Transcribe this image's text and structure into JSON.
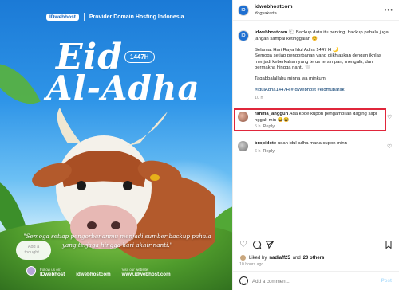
{
  "poster": {
    "brand_logo": "IDwebhost",
    "brand_tagline": "Provider Domain Hosting Indonesia",
    "title_eid": "Eid",
    "title_year": "1447H",
    "title_adha": "Al-Adha",
    "quote": "\"Semoga setiap pengorbananmu menjadi sumber backup pahala yang terjaga hingga hari akhir nanti.\"",
    "thought_bubble": "Add a thought...",
    "footer": {
      "follow_label": "Follow us on:",
      "handle_1": "IDwebhost",
      "handle_2": "idwebhostcom",
      "visit_label": "Visit our website:",
      "website": "www.idwebhost.com"
    }
  },
  "post": {
    "header": {
      "username": "idwebhostcom",
      "location": "Yogyakarta",
      "more_icon": "more-horizontal-icon"
    },
    "caption": {
      "username": "idwebhostcom",
      "p1": "🐑 Backup data itu penting, backup pahala juga jangan sampai ketinggalan 😊",
      "p2": "Selamat Hari Raya Idul Adha 1447 H 🌙",
      "p3": "Semoga setiap pengorbanan yang diikhlaskan dengan ikhlas menjadi keberkahan yang terus tersimpan, mengalir, dan bermakna hingga nanti. 🤍",
      "p4": "Taqabbalallahu minna wa minkum.",
      "tags": "#IdulAdha1447H #IdWebhost #eidmubarak",
      "time": "10 h"
    },
    "comments": [
      {
        "username": "rahma_anggun",
        "text": "Ada kode kupon pengambilan daging sapi nggak min 😂😂",
        "time": "5 h",
        "reply": "Reply"
      },
      {
        "username": "bropidote",
        "text": "udah idul adha mana cupon minn",
        "time": "6 h",
        "reply": "Reply"
      }
    ],
    "likes": {
      "prefix": "Liked by",
      "user": "nadiaff25",
      "and": "and",
      "others": "20 others"
    },
    "time_ago": "10 hours ago",
    "add_comment": {
      "placeholder": "Add a comment...",
      "post_label": "Post"
    }
  }
}
